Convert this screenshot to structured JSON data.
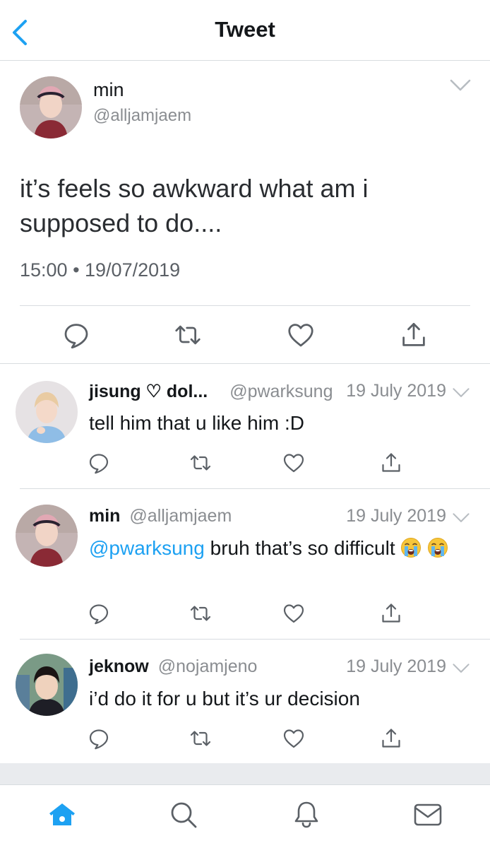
{
  "header": {
    "title": "Tweet"
  },
  "main_tweet": {
    "name": "min",
    "handle": "@alljamjaem",
    "text": "it’s feels so awkward what am i supposed to do....",
    "timestamp": "15:00 • 19/07/2019"
  },
  "replies": [
    {
      "name": "jisung ♡ dol...",
      "handle": "@pwarksung",
      "date": "19 July 2019",
      "text": "tell him that u like him :D"
    },
    {
      "name": "min",
      "handle": "@alljamjaem",
      "date": "19 July 2019",
      "mention": "@pwarksung",
      "text": " bruh that’s so difficult "
    },
    {
      "name": "jeknow",
      "handle": "@nojamjeno",
      "date": "19 July 2019",
      "text": "i’d do it for u but it’s ur decision"
    }
  ],
  "icons": {
    "header": [
      "back-chevron-icon"
    ],
    "actions": [
      "reply-icon",
      "retweet-icon",
      "like-icon",
      "share-icon"
    ],
    "tabbar": [
      "home-icon",
      "search-icon",
      "notifications-icon",
      "messages-icon"
    ]
  },
  "colors": {
    "accent": "#1da1f2",
    "text": "#14171a",
    "secondary": "#8a8d91",
    "divider": "#d8dce0"
  }
}
